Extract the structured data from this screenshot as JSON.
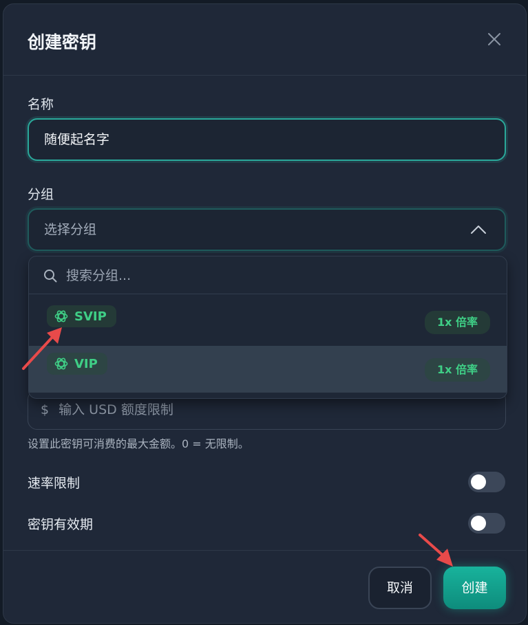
{
  "modal": {
    "title": "创建密钥",
    "name_label": "名称",
    "name_value": "随便起名字",
    "group_label": "分组",
    "group_placeholder": "选择分组",
    "search_placeholder": "搜索分组...",
    "options": [
      {
        "name": "SVIP",
        "multiplier": "1x 倍率"
      },
      {
        "name": "VIP",
        "multiplier": "1x 倍率"
      }
    ],
    "usd_symbol": "$",
    "usd_placeholder": "输入 USD 额度限制",
    "usd_help": "设置此密钥可消费的最大金额。0 = 无限制。",
    "rate_limit_label": "速率限制",
    "expiry_label": "密钥有效期",
    "cancel_label": "取消",
    "create_label": "创建"
  },
  "colors": {
    "accent": "#14a896",
    "tag_green": "#3fcf86",
    "annotation_red": "#e84a4a"
  },
  "icons": {
    "close": "close-icon",
    "chevron": "chevron-up-icon",
    "search": "search-icon",
    "openai": "openai-logo-icon"
  }
}
